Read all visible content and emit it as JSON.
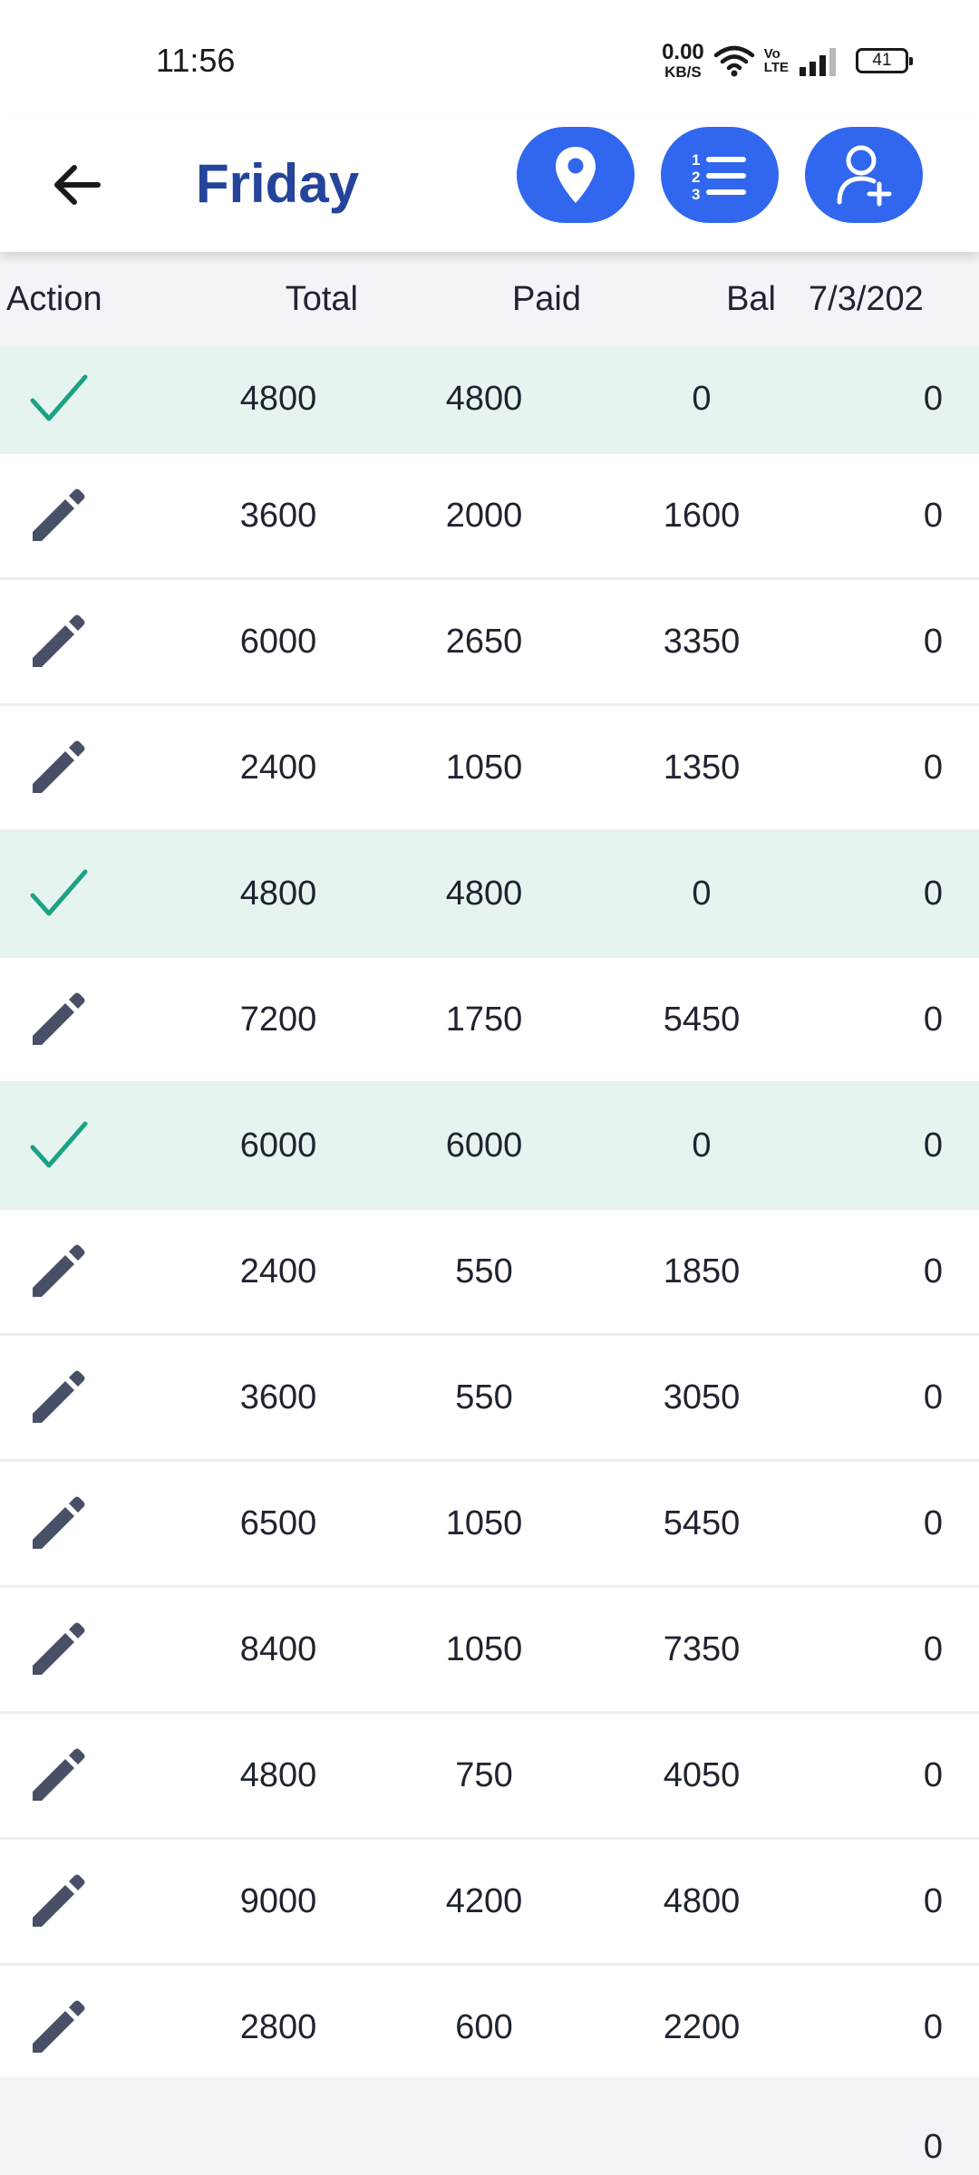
{
  "status_bar": {
    "time": "11:56",
    "net_speed_value": "0.00",
    "net_speed_unit": "KB/S",
    "volte_top": "Vo",
    "volte_bottom": "LTE",
    "battery": "41"
  },
  "header": {
    "title": "Friday",
    "back_icon": "arrow-left-icon",
    "actions": [
      {
        "icon": "map-pin-icon"
      },
      {
        "icon": "numbered-list-icon"
      },
      {
        "icon": "add-user-icon"
      }
    ]
  },
  "colors": {
    "accent": "#3167ee",
    "title": "#24439a",
    "paid_row_bg": "#e6f4f0",
    "check": "#1aa283",
    "edit_icon": "#475066"
  },
  "table": {
    "columns": [
      "Action",
      "Total",
      "Paid",
      "Bal",
      "7/3/202"
    ],
    "rows": [
      {
        "status": "paid",
        "icon": "check-icon",
        "total": "4800",
        "paid": "4800",
        "bal": "0",
        "date_amt": "0"
      },
      {
        "status": "due",
        "icon": "edit-pencil-icon",
        "total": "3600",
        "paid": "2000",
        "bal": "1600",
        "date_amt": "0"
      },
      {
        "status": "due",
        "icon": "edit-pencil-icon",
        "total": "6000",
        "paid": "2650",
        "bal": "3350",
        "date_amt": "0"
      },
      {
        "status": "due",
        "icon": "edit-pencil-icon",
        "total": "2400",
        "paid": "1050",
        "bal": "1350",
        "date_amt": "0"
      },
      {
        "status": "paid",
        "icon": "check-icon",
        "total": "4800",
        "paid": "4800",
        "bal": "0",
        "date_amt": "0"
      },
      {
        "status": "due",
        "icon": "edit-pencil-icon",
        "total": "7200",
        "paid": "1750",
        "bal": "5450",
        "date_amt": "0"
      },
      {
        "status": "paid",
        "icon": "check-icon",
        "total": "6000",
        "paid": "6000",
        "bal": "0",
        "date_amt": "0"
      },
      {
        "status": "due",
        "icon": "edit-pencil-icon",
        "total": "2400",
        "paid": "550",
        "bal": "1850",
        "date_amt": "0"
      },
      {
        "status": "due",
        "icon": "edit-pencil-icon",
        "total": "3600",
        "paid": "550",
        "bal": "3050",
        "date_amt": "0"
      },
      {
        "status": "due",
        "icon": "edit-pencil-icon",
        "total": "6500",
        "paid": "1050",
        "bal": "5450",
        "date_amt": "0"
      },
      {
        "status": "due",
        "icon": "edit-pencil-icon",
        "total": "8400",
        "paid": "1050",
        "bal": "7350",
        "date_amt": "0"
      },
      {
        "status": "due",
        "icon": "edit-pencil-icon",
        "total": "4800",
        "paid": "750",
        "bal": "4050",
        "date_amt": "0"
      },
      {
        "status": "due",
        "icon": "edit-pencil-icon",
        "total": "9000",
        "paid": "4200",
        "bal": "4800",
        "date_amt": "0"
      },
      {
        "status": "due",
        "icon": "edit-pencil-icon",
        "total": "2800",
        "paid": "600",
        "bal": "2200",
        "date_amt": "0"
      }
    ],
    "footer_total": "0"
  }
}
